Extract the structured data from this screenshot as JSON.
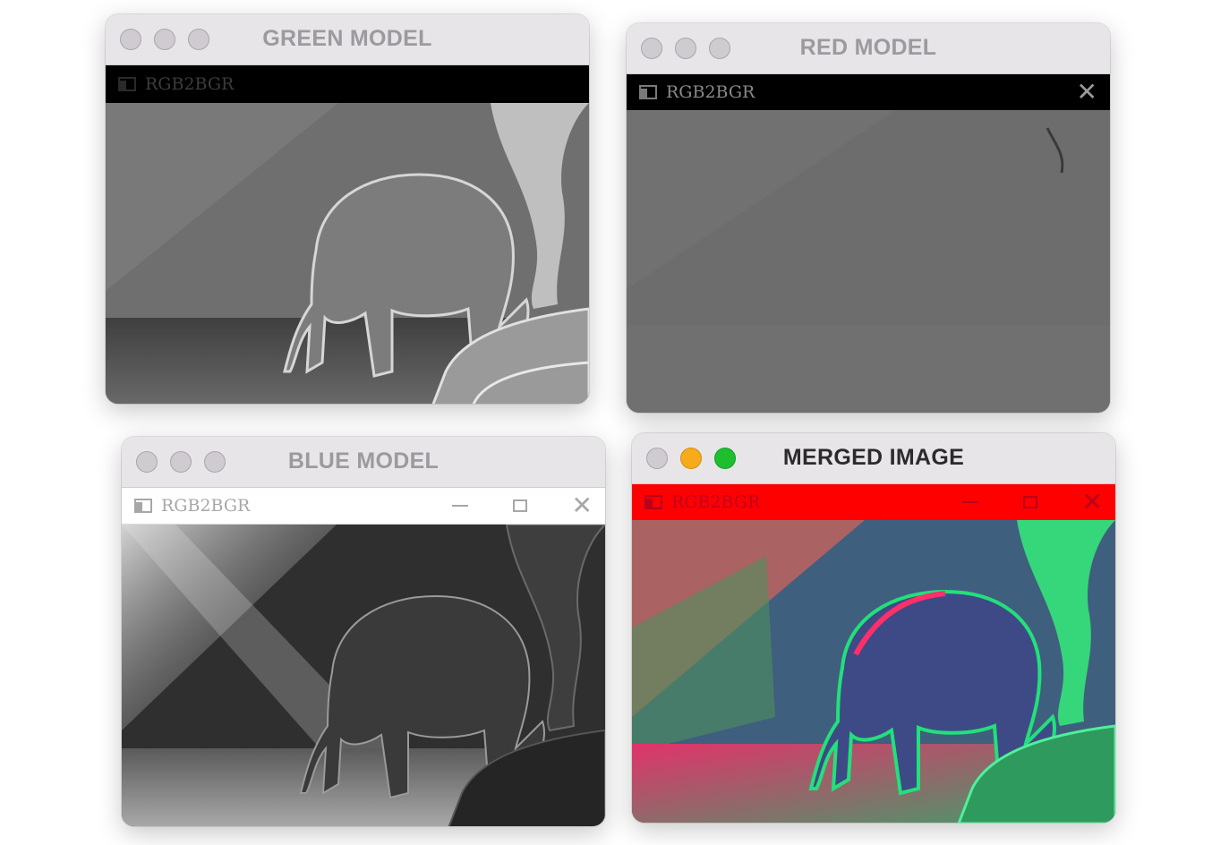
{
  "windows": {
    "green": {
      "title": "GREEN MODEL",
      "subbar_label": "RGB2BGR",
      "image_alt": "green channel grayscale image of baby elephant"
    },
    "red": {
      "title": "RED MODEL",
      "subbar_label": "RGB2BGR",
      "close_glyph": "✕",
      "image_alt": "red channel grayscale image, mostly flat gray"
    },
    "blue": {
      "title": "BLUE MODEL",
      "subbar_label": "RGB2BGR",
      "close_glyph": "✕",
      "image_alt": "blue channel grayscale image of baby elephant with light rays"
    },
    "merged": {
      "title": "MERGED IMAGE",
      "subbar_label": "RGB2BGR",
      "close_glyph": "✕",
      "image_alt": "merged color image of baby elephant in green and red tones"
    }
  },
  "colors": {
    "traffic_inactive": "#cfcbd0",
    "traffic_yellow": "#f5ab1b",
    "traffic_green": "#1dbf2f",
    "merged_subbar": "#ff0000"
  },
  "icons": [
    "close-traffic-light-icon",
    "minimize-traffic-light-icon",
    "zoom-traffic-light-icon",
    "window-app-icon",
    "minimize-icon",
    "maximize-icon",
    "close-icon"
  ]
}
